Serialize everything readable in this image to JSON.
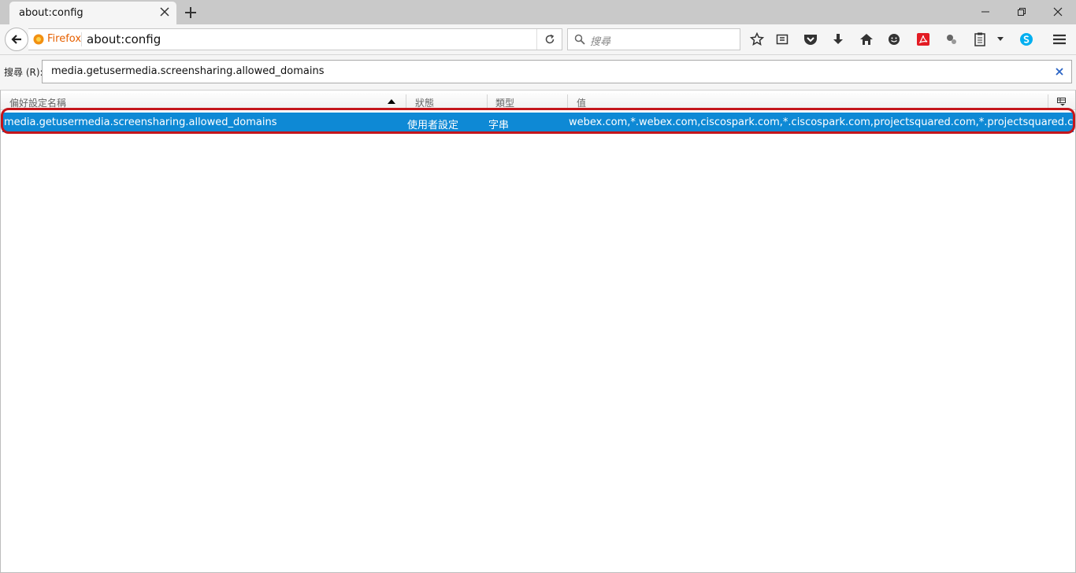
{
  "tab": {
    "title": "about:config"
  },
  "navbar": {
    "identity_label": "Firefox",
    "url": "about:config",
    "search_placeholder": "搜尋"
  },
  "filter": {
    "label": "搜尋 (R):",
    "value": "media.getusermedia.screensharing.allowed_domains"
  },
  "columns": {
    "name": "偏好設定名稱",
    "status": "狀態",
    "type": "類型",
    "value": "值"
  },
  "rows": [
    {
      "name": "media.getusermedia.screensharing.allowed_domains",
      "status": "使用者設定",
      "type": "字串",
      "value": "webex.com,*.webex.com,ciscospark.com,*.ciscospark.com,projectsquared.com,*.projectsquared.com,*.room...."
    }
  ],
  "colors": {
    "selection": "#0e89d5",
    "annotation": "#c4161c",
    "firefox_orange": "#e66000"
  }
}
